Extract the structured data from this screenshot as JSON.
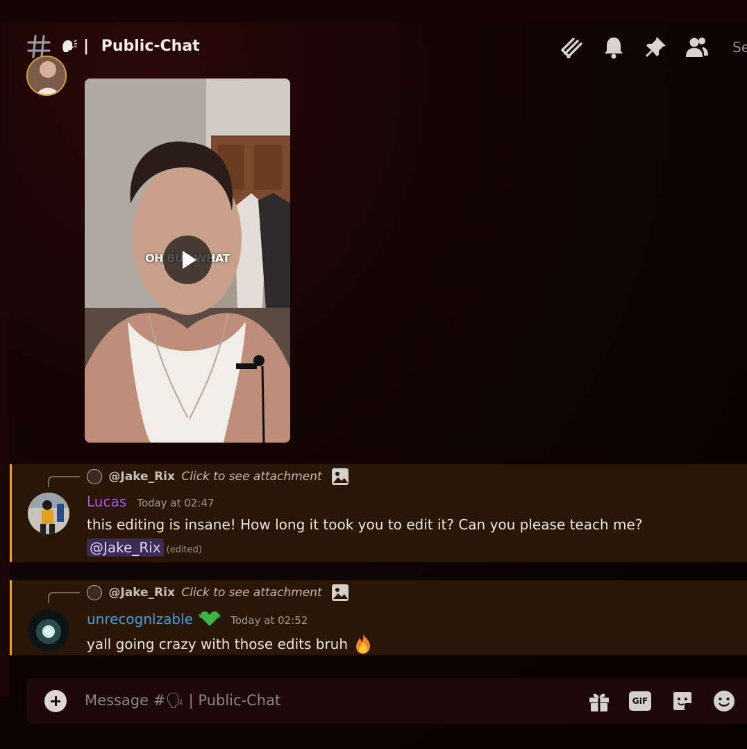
{
  "channel": {
    "hash": "#",
    "emoji": "speaking-head",
    "name": "Public-Chat",
    "separator": "|"
  },
  "header": {
    "icons": [
      "threads-icon",
      "bell-icon",
      "pin-icon",
      "members-icon"
    ],
    "search_fragment": "Se"
  },
  "video": {
    "caption": "OH BUT WHAT"
  },
  "messages": [
    {
      "reply": {
        "name": "@Jake_Rix",
        "text": "Click to see attachment"
      },
      "author": "Lucas",
      "author_color": "#a35be8",
      "timestamp": "Today at 02:47",
      "text": "this editing is insane! How long it took you to edit it? Can you please teach me?",
      "mention": "@Jake_Rix",
      "edited": "(edited)"
    },
    {
      "reply": {
        "name": "@Jake_Rix",
        "text": "Click to see attachment"
      },
      "author": "unrecognlzable",
      "author_color": "#3da0e6",
      "timestamp": "Today at 02:52",
      "text": "yall going crazy with those edits bruh",
      "badge": "green-heart-icon",
      "trailing_emoji": "fire-icon"
    }
  ],
  "composer": {
    "placeholder": "Message #🗣 | Public-Chat",
    "gif_label": "GIF"
  },
  "colors": {
    "highlight": "#e3a42c",
    "message_bg": "#2a1607"
  }
}
